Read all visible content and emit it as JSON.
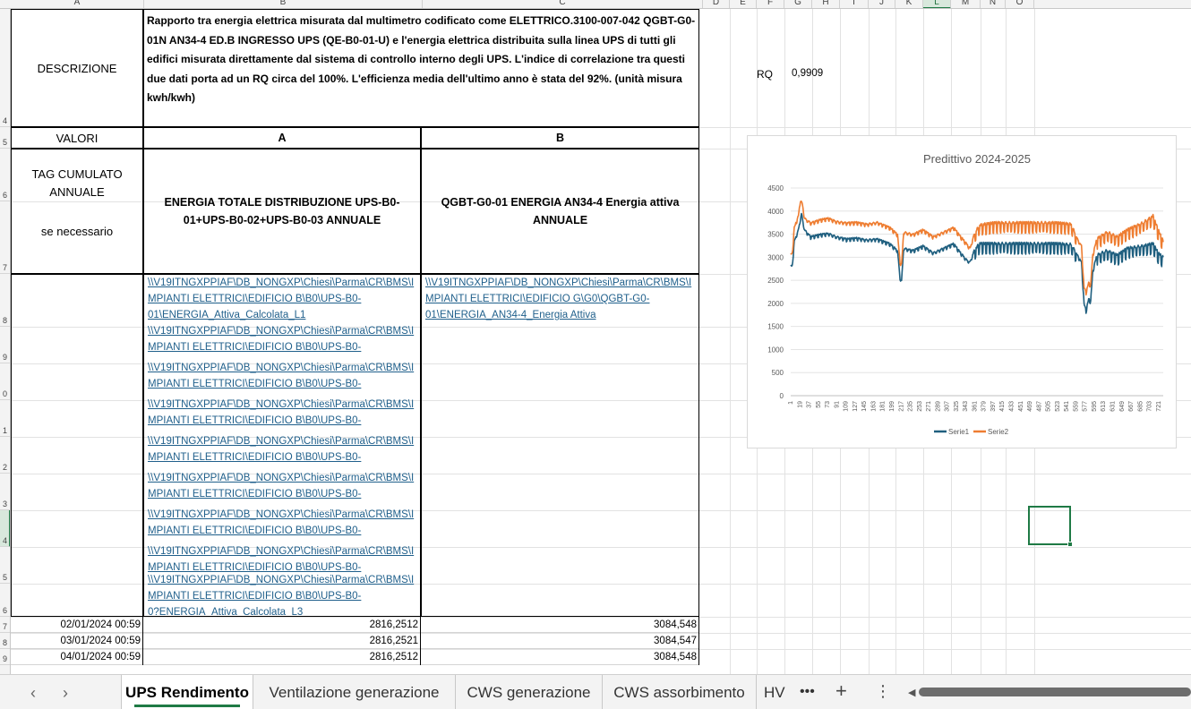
{
  "columns": [
    "A",
    "B",
    "C",
    "D",
    "E",
    "F",
    "G",
    "H",
    "I",
    "J",
    "K",
    "L",
    "M",
    "N",
    "O"
  ],
  "rows": [
    "4",
    "5",
    "6",
    "7",
    "8",
    "9",
    "0",
    "1",
    "2",
    "3",
    "4",
    "5",
    "6",
    "7",
    "8",
    "9"
  ],
  "table": {
    "desc_label": "DESCRIZIONE",
    "description": "Rapporto tra energia elettrica misurata dal multimetro codificato come ELETTRICO.3100-007-042 QGBT-G0-01N AN34-4 ED.B INGRESSO UPS (QE-B0-01-U) e l'energia elettrica distribuita sulla linea UPS di tutti gli edifici misurata direttamente dal sistema di controllo interno degli UPS. L'indice di correlazione tra questi due dati porta ad un RQ circa del 100%. L'efficienza media dell'ultimo anno è stata del 92%. (unità misura kwh/kwh)",
    "valori_label": "VALORI",
    "col_a_label": "A",
    "col_b_label": "B",
    "tag_line1": "TAG CUMULATO",
    "tag_line2": "ANNUALE",
    "tag_line3": "se necessario",
    "energy_a_title": "ENERGIA TOTALE DISTRIBUZIONE UPS-B0-01+UPS-B0-02+UPS-B0-03 ANNUALE",
    "energy_b_title": "QGBT-G0-01 ENERGIA AN34-4 Energia attiva ANNUALE",
    "link_a_first": [
      "\\\\V19ITNGXPPIAF\\DB_NONGXP\\Chiesi\\Parma\\CR\\BMS\\I",
      "MPIANTI ELETTRICI\\EDIFICIO B\\B0\\UPS-B0-",
      "01\\ENERGIA_Attiva_Calcolata_L1"
    ],
    "link_a_repeat": [
      "\\\\V19ITNGXPPIAF\\DB_NONGXP\\Chiesi\\Parma\\CR\\BMS\\I",
      "MPIANTI ELETTRICI\\EDIFICIO B\\B0\\UPS-B0-"
    ],
    "link_a_last": [
      "\\\\V19ITNGXPPIAF\\DB_NONGXP\\Chiesi\\Parma\\CR\\BMS\\I",
      "MPIANTI ELETTRICI\\EDIFICIO B\\B0\\UPS-B0-",
      "0?ENERGIA_Attiva_Calcolata_L3"
    ],
    "link_b": [
      "\\\\V19ITNGXPPIAF\\DB_NONGXP\\Chiesi\\Parma\\CR\\BMS\\I",
      "MPIANTI ELETTRICI\\EDIFICIO G\\G0\\QGBT-G0-",
      "01\\ENERGIA_AN34-4_Energia Attiva"
    ],
    "data_rows": [
      {
        "date": "02/01/2024 00:59",
        "a": "2816,2512",
        "b": "3084,548"
      },
      {
        "date": "03/01/2024 00:59",
        "a": "2816,2521",
        "b": "3084,547"
      },
      {
        "date": "04/01/2024 00:59",
        "a": "2816,2512",
        "b": "3084,548"
      }
    ]
  },
  "rq": {
    "label": "RQ",
    "value": "0,9909"
  },
  "chart_data": {
    "type": "line",
    "title": "Predittivo 2024-2025",
    "ylim": [
      0,
      4500
    ],
    "yticks": [
      0,
      500,
      1000,
      1500,
      2000,
      2500,
      3000,
      3500,
      4000,
      4500
    ],
    "xticks": [
      1,
      19,
      37,
      55,
      73,
      91,
      109,
      127,
      145,
      163,
      181,
      199,
      217,
      235,
      253,
      271,
      289,
      307,
      325,
      343,
      361,
      379,
      397,
      415,
      433,
      451,
      469,
      487,
      505,
      523,
      541,
      559,
      577,
      595,
      613,
      631,
      649,
      667,
      685,
      703,
      721
    ],
    "xmax": 730,
    "grid": "horizontal",
    "legend_position": "bottom",
    "series": [
      {
        "name": "Serie1",
        "color": "#1f5f7f",
        "keypoints": [
          [
            1,
            2820
          ],
          [
            4,
            2820
          ],
          [
            8,
            3350
          ],
          [
            16,
            3600
          ],
          [
            22,
            3950
          ],
          [
            28,
            3600
          ],
          [
            40,
            3450
          ],
          [
            60,
            3500
          ],
          [
            75,
            3520
          ],
          [
            90,
            3450
          ],
          [
            110,
            3400
          ],
          [
            130,
            3420
          ],
          [
            150,
            3380
          ],
          [
            170,
            3400
          ],
          [
            195,
            3300
          ],
          [
            210,
            3150
          ],
          [
            215,
            2550
          ],
          [
            218,
            2500
          ],
          [
            222,
            3200
          ],
          [
            240,
            3150
          ],
          [
            260,
            3250
          ],
          [
            280,
            3100
          ],
          [
            300,
            3200
          ],
          [
            320,
            3300
          ],
          [
            330,
            3150
          ],
          [
            345,
            2950
          ],
          [
            352,
            2900
          ],
          [
            360,
            3150
          ],
          [
            370,
            3300
          ],
          [
            400,
            3300
          ],
          [
            440,
            3300
          ],
          [
            480,
            3300
          ],
          [
            520,
            3300
          ],
          [
            550,
            3280
          ],
          [
            562,
            3050
          ],
          [
            570,
            2900
          ],
          [
            575,
            2000
          ],
          [
            579,
            1850
          ],
          [
            584,
            2100
          ],
          [
            588,
            2050
          ],
          [
            592,
            2700
          ],
          [
            600,
            3050
          ],
          [
            620,
            3150
          ],
          [
            640,
            3050
          ],
          [
            660,
            3200
          ],
          [
            690,
            3250
          ],
          [
            710,
            3300
          ],
          [
            720,
            3100
          ],
          [
            730,
            3000
          ]
        ]
      },
      {
        "name": "Serie2",
        "color": "#ee7d31",
        "keypoints": [
          [
            1,
            3080
          ],
          [
            4,
            3080
          ],
          [
            8,
            3650
          ],
          [
            16,
            3900
          ],
          [
            20,
            4250
          ],
          [
            24,
            4150
          ],
          [
            28,
            3850
          ],
          [
            40,
            3750
          ],
          [
            60,
            3820
          ],
          [
            75,
            3850
          ],
          [
            90,
            3780
          ],
          [
            110,
            3750
          ],
          [
            130,
            3760
          ],
          [
            150,
            3720
          ],
          [
            170,
            3760
          ],
          [
            195,
            3650
          ],
          [
            210,
            3500
          ],
          [
            215,
            2900
          ],
          [
            218,
            2850
          ],
          [
            222,
            3550
          ],
          [
            240,
            3500
          ],
          [
            260,
            3600
          ],
          [
            280,
            3450
          ],
          [
            300,
            3550
          ],
          [
            320,
            3650
          ],
          [
            330,
            3500
          ],
          [
            345,
            3300
          ],
          [
            352,
            3200
          ],
          [
            360,
            3500
          ],
          [
            370,
            3700
          ],
          [
            400,
            3750
          ],
          [
            440,
            3750
          ],
          [
            480,
            3750
          ],
          [
            520,
            3750
          ],
          [
            550,
            3720
          ],
          [
            562,
            3400
          ],
          [
            570,
            3250
          ],
          [
            575,
            2350
          ],
          [
            579,
            2250
          ],
          [
            584,
            2450
          ],
          [
            588,
            2400
          ],
          [
            592,
            3050
          ],
          [
            600,
            3400
          ],
          [
            620,
            3550
          ],
          [
            640,
            3450
          ],
          [
            660,
            3600
          ],
          [
            690,
            3750
          ],
          [
            710,
            3900
          ],
          [
            720,
            3600
          ],
          [
            730,
            3350
          ]
        ]
      }
    ]
  },
  "tabs": [
    {
      "label": "UPS Rendimento",
      "active": true
    },
    {
      "label": "Ventilazione generazione",
      "active": false
    },
    {
      "label": "CWS generazione",
      "active": false
    },
    {
      "label": "CWS assorbimento",
      "active": false
    },
    {
      "label": "HV",
      "active": false
    }
  ],
  "icons": {
    "prev": "‹",
    "next": "›",
    "more": "•••",
    "add": "+",
    "options": "⋮",
    "scroll_left": "◀"
  },
  "colors": {
    "accent": "#1f7a45",
    "link": "#1f5f8b"
  }
}
